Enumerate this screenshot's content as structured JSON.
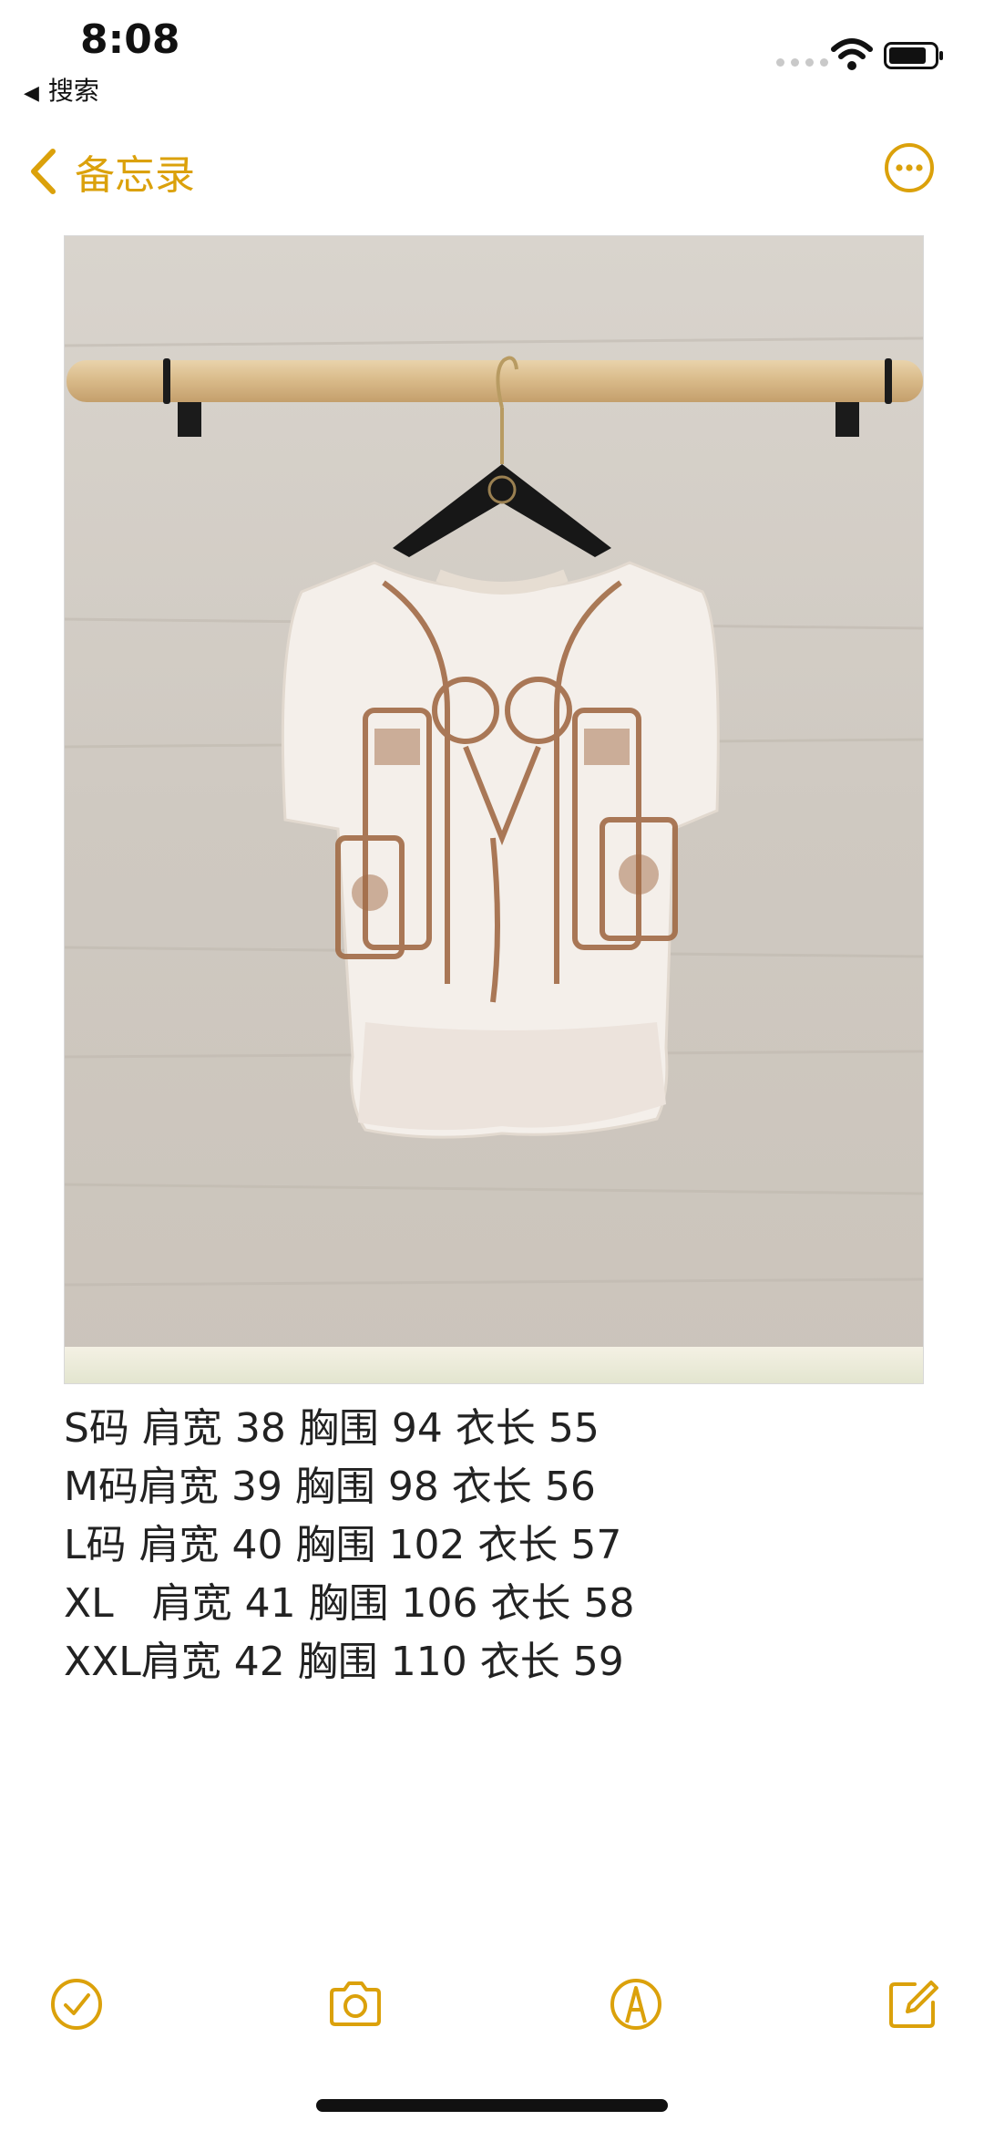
{
  "status_bar": {
    "time": "8:08",
    "back_app": "搜索",
    "back_arrow": "◀"
  },
  "nav": {
    "back_label": "备忘录",
    "more_icon": "ellipsis-circle-icon"
  },
  "note": {
    "image": "product-photo",
    "sizes": [
      "S码 肩宽 38 胸围 94 衣长 55",
      "M码肩宽 39 胸围 98 衣长 56",
      "L码 肩宽 40 胸围 102 衣长 57",
      "XL   肩宽 41 胸围 106 衣长 58",
      "XXL肩宽 42 胸围 110 衣长 59"
    ]
  },
  "toolbar": {
    "icons": [
      "checklist-icon",
      "camera-icon",
      "markup-icon",
      "compose-icon"
    ]
  },
  "colors": {
    "accent": "#dba10b",
    "text": "#222222",
    "background": "#ffffff"
  }
}
